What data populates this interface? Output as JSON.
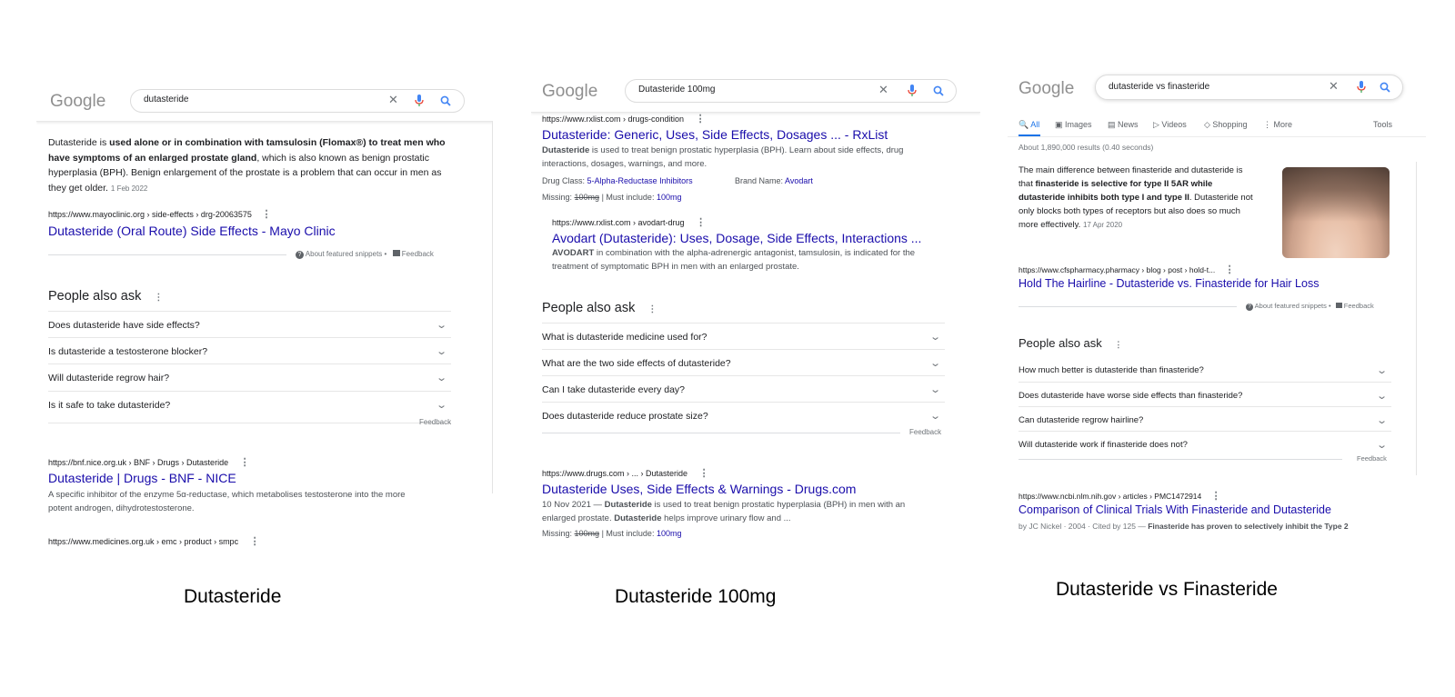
{
  "panels": {
    "p1": {
      "logo": "Google",
      "query": "dutasteride",
      "featured": {
        "text_parts": [
          {
            "t": "Dutasteride is ",
            "b": false
          },
          {
            "t": "used alone or in combination with tamsulosin (Flomax®) to treat men who have symptoms of an enlarged prostate gland",
            "b": true
          },
          {
            "t": ", which is also known as benign prostatic hyperplasia (BPH). Benign enlargement of the prostate is a problem that can occur in men as they get older.",
            "b": false
          }
        ],
        "date": "1 Feb 2022",
        "cite": "https://www.mayoclinic.org › side-effects › drg-20063575",
        "title": "Dutasteride (Oral Route) Side Effects - Mayo Clinic",
        "about": "About featured snippets",
        "feedback": "Feedback"
      },
      "paa": {
        "title": "People also ask",
        "questions": [
          "Does dutasteride have side effects?",
          "Is dutasteride a testosterone blocker?",
          "Will dutasteride regrow hair?",
          "Is it safe to take dutasteride?"
        ],
        "feedback": "Feedback"
      },
      "result1": {
        "cite": "https://bnf.nice.org.uk › BNF › Drugs › Dutasteride",
        "title": "Dutasteride | Drugs - BNF - NICE",
        "snippet_l1": "A specific inhibitor of the enzyme 5α-reductase, which metabolises testosterone into the more",
        "snippet_l2": "potent androgen, dihydrotestosterone."
      },
      "result2_cite": "https://www.medicines.org.uk › emc › product › smpc"
    },
    "p2": {
      "logo": "Google",
      "query": "Dutasteride 100mg",
      "r1": {
        "cite": "https://www.rxlist.com › drugs-condition",
        "title": "Dutasteride: Generic, Uses, Side Effects, Dosages ... - RxList",
        "snip_b": "Dutasteride",
        "snip_l1": " is used to treat benign prostatic hyperplasia (BPH). Learn about side effects, drug",
        "snip_l2": "interactions, dosages, warnings, and more.",
        "drug_class_label": "Drug Class:",
        "drug_class": "5-Alpha-Reductase Inhibitors",
        "brand_label": "Brand Name:",
        "brand": "Avodart",
        "missing_label": "Missing:",
        "missing": "100mg",
        "must_label": "| Must include:",
        "must": "100mg"
      },
      "r1b": {
        "cite": "https://www.rxlist.com › avodart-drug",
        "title": "Avodart (Dutasteride): Uses, Dosage, Side Effects, Interactions ...",
        "snip_b": "AVODART",
        "snip_l1": " in combination with the alpha-adrenergic antagonist, tamsulosin, is indicated for the",
        "snip_l2": "treatment of symptomatic BPH in men with an enlarged prostate."
      },
      "paa": {
        "title": "People also ask",
        "questions": [
          "What is dutasteride medicine used for?",
          "What are the two side effects of dutasteride?",
          "Can I take dutasteride every day?",
          "Does dutasteride reduce prostate size?"
        ],
        "feedback": "Feedback"
      },
      "r2": {
        "cite": "https://www.drugs.com › ... › Dutasteride",
        "title": "Dutasteride Uses, Side Effects & Warnings - Drugs.com",
        "date": "10 Nov 2021 — ",
        "snip_b": "Dutasteride",
        "snip_l1": " is used to treat benign prostatic hyperplasia (BPH) in men with an",
        "snip_l2a": "enlarged prostate. ",
        "snip_l2b": "Dutasteride",
        "snip_l2c": " helps improve urinary flow and ...",
        "missing_label": "Missing:",
        "missing": "100mg",
        "must_label": "| Must include:",
        "must": "100mg"
      }
    },
    "p3": {
      "logo": "Google",
      "query": "dutasteride vs finasteride",
      "tabs": [
        "All",
        "Images",
        "News",
        "Videos",
        "Shopping",
        "More"
      ],
      "tools": "Tools",
      "stats": "About 1,890,000 results (0.40 seconds)",
      "featured": {
        "l1": "The main difference between finasteride and dutasteride is",
        "l2a": "that ",
        "l2b": "finasteride is selective for type II 5AR while",
        "l3b": "dutasteride inhibits both type I and type II",
        "l3c": ". Dutasteride not",
        "l4": "only blocks both types of receptors but also does so much",
        "l5": "more effectively.",
        "date": "17 Apr 2020",
        "cite": "https://www.cfspharmacy.pharmacy › blog › post › hold-t...",
        "title": "Hold The Hairline - Dutasteride vs. Finasteride for Hair Loss",
        "about": "About featured snippets",
        "feedback": "Feedback"
      },
      "paa": {
        "title": "People also ask",
        "questions": [
          "How much better is dutasteride than finasteride?",
          "Does dutasteride have worse side effects than finasteride?",
          "Can dutasteride regrow hairline?",
          "Will dutasteride work if finasteride does not?"
        ],
        "feedback": "Feedback"
      },
      "r2": {
        "cite": "https://www.ncbi.nlm.nih.gov › articles › PMC1472914",
        "title": "Comparison of Clinical Trials With Finasteride and Dutasteride",
        "snip_a": "by JC Nickel · 2004 · Cited by 125 — ",
        "snip_b": "Finasteride has proven to selectively inhibit the Type 2"
      }
    }
  },
  "captions": [
    "Dutasteride",
    "Dutasteride 100mg",
    "Dutasteride vs Finasteride"
  ],
  "icons": {
    "clear": "close-icon",
    "voice": "mic-icon",
    "search": "search-icon",
    "more": "three-dots-icon",
    "expand": "chevron-down-icon"
  },
  "colors": {
    "link": "#1a0dab",
    "google_blue": "#4285f4",
    "text": "#202124",
    "muted": "#70757a"
  }
}
